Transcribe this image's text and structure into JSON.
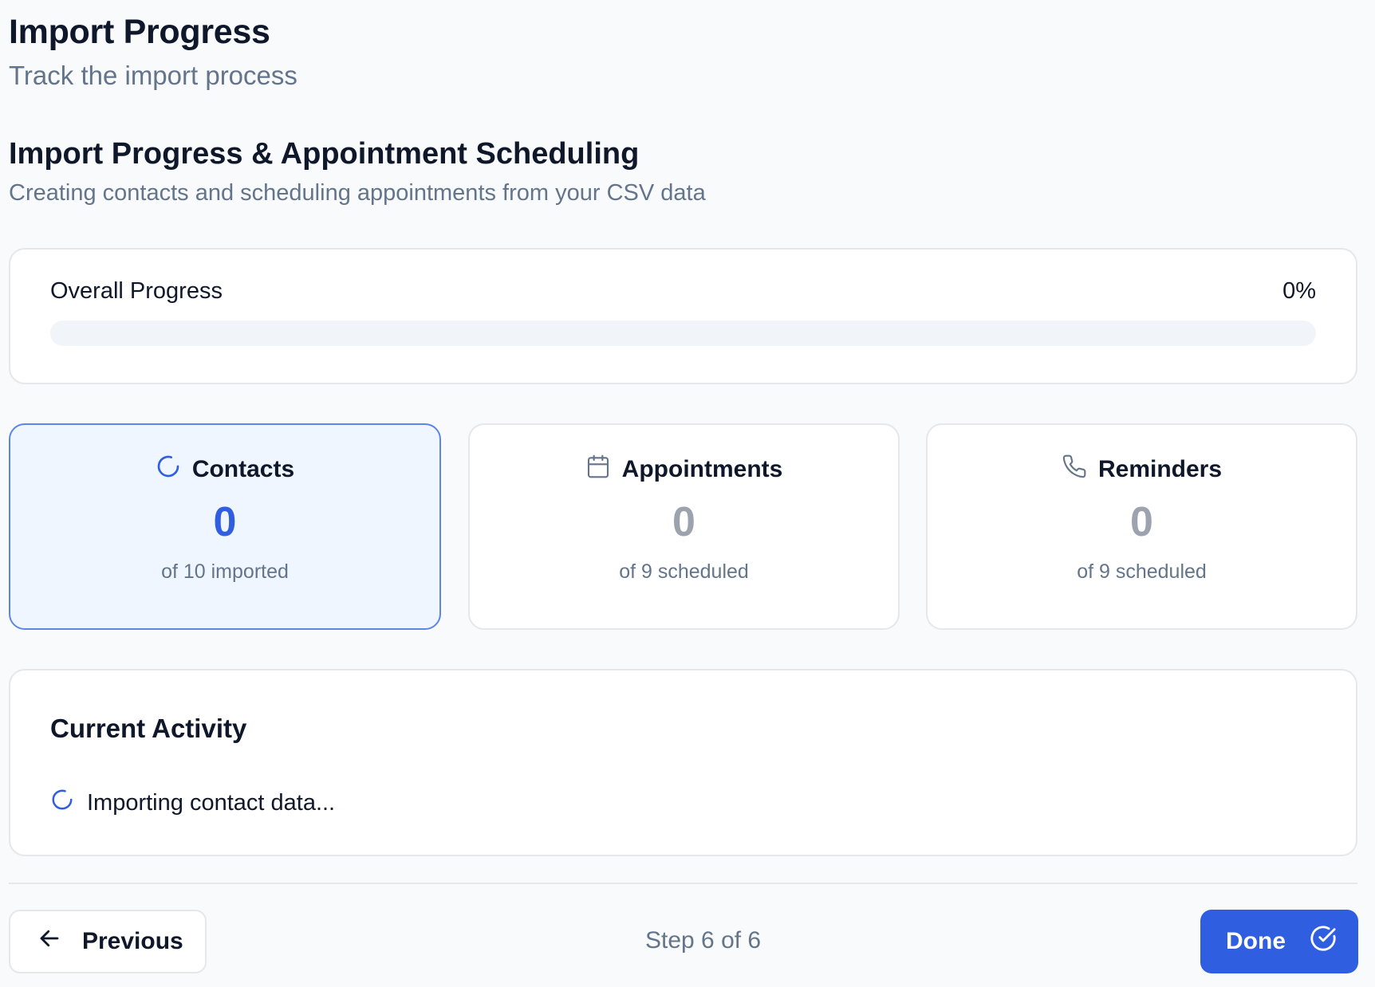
{
  "header": {
    "title": "Import Progress",
    "subtitle": "Track the import process"
  },
  "section": {
    "title": "Import Progress & Appointment Scheduling",
    "subtitle": "Creating contacts and scheduling appointments from your CSV data"
  },
  "overall": {
    "label": "Overall Progress",
    "value_text": "0%",
    "percent": 0
  },
  "stats": [
    {
      "label": "Contacts",
      "icon": "loader-icon",
      "count": "0",
      "caption": "of 10 imported",
      "active": true
    },
    {
      "label": "Appointments",
      "icon": "calendar-icon",
      "count": "0",
      "caption": "of 9 scheduled",
      "active": false
    },
    {
      "label": "Reminders",
      "icon": "phone-icon",
      "count": "0",
      "caption": "of 9 scheduled",
      "active": false
    }
  ],
  "activity": {
    "title": "Current Activity",
    "status": "Importing contact data...",
    "icon": "loader-icon"
  },
  "footer": {
    "previous_label": "Previous",
    "step_text": "Step 6 of 6",
    "done_label": "Done"
  },
  "colors": {
    "accent": "#2f5ee0",
    "active_card_bg": "#eff6ff",
    "muted_text": "#64748b",
    "inactive_number": "#9ca3af"
  }
}
